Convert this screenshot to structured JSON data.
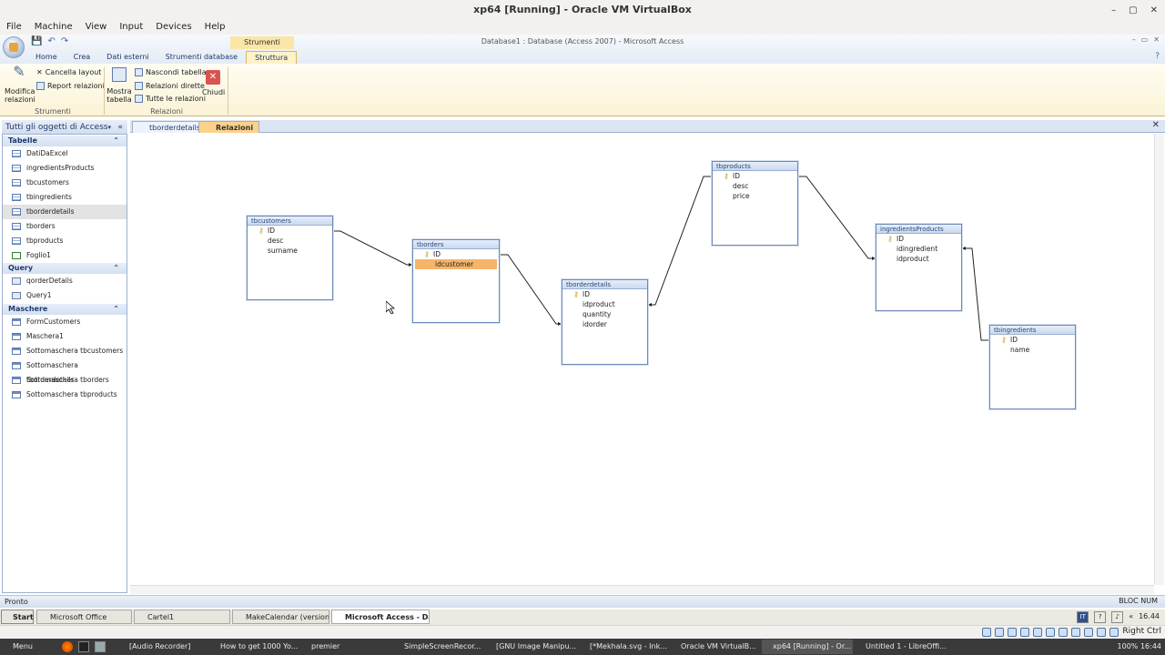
{
  "host": {
    "title": "xp64 [Running] - Oracle VM VirtualBox",
    "menu": [
      "File",
      "Machine",
      "View",
      "Input",
      "Devices",
      "Help"
    ],
    "window_controls": [
      "–",
      "▢",
      "✕"
    ]
  },
  "access": {
    "doc_title": "Database1 : Database (Access 2007) - Microsoft Access",
    "context_group": "Strumenti relazione",
    "tabs": [
      "Home",
      "Crea",
      "Dati esterni",
      "Strumenti database",
      "Struttura"
    ],
    "active_tab": "Struttura",
    "ribbon": {
      "modifica": "Modifica\nrelazioni",
      "cancella": "Cancella layout",
      "report": "Report relazioni",
      "mostra": "Mostra\ntabella",
      "nascondi": "Nascondi tabella",
      "dirette": "Relazioni dirette",
      "tutte": "Tutte le relazioni",
      "chiudi": "Chiudi",
      "group_strumenti": "Strumenti",
      "group_relazioni": "Relazioni"
    }
  },
  "nav": {
    "header": "Tutti gli oggetti di Access",
    "sections": [
      {
        "title": "Tabelle",
        "items": [
          "DatiDaExcel",
          "ingredientsProducts",
          "tbcustomers",
          "tbingredients",
          "tborderdetails",
          "tborders",
          "tbproducts",
          "Foglio1"
        ]
      },
      {
        "title": "Query",
        "items": [
          "qorderDetails",
          "Query1"
        ]
      },
      {
        "title": "Maschere",
        "items": [
          "FormCustomers",
          "Maschera1",
          "Sottomaschera tbcustomers",
          "Sottomaschera tborderdetails",
          "Sottomaschera tborders",
          "Sottomaschera tbproducts"
        ]
      }
    ],
    "selected": "tborderdetails"
  },
  "doc_tabs": [
    "tborderdetails",
    "Relazioni"
  ],
  "active_doc_tab": "Relazioni",
  "tables": {
    "tbcustomers": {
      "name": "tbcustomers",
      "fields": [
        "ID",
        "desc",
        "surname"
      ]
    },
    "tborders": {
      "name": "tborders",
      "fields": [
        "ID",
        "idcustomer"
      ]
    },
    "tborderdetails": {
      "name": "tborderdetails",
      "fields": [
        "ID",
        "idproduct",
        "quantity",
        "idorder"
      ]
    },
    "tbproducts": {
      "name": "tbproducts",
      "fields": [
        "ID",
        "desc",
        "price"
      ]
    },
    "ingredientsProducts": {
      "name": "ingredientsProducts",
      "fields": [
        "ID",
        "idingredient",
        "idproduct"
      ]
    },
    "tbingredients": {
      "name": "tbingredients",
      "fields": [
        "ID",
        "name"
      ]
    }
  },
  "status": {
    "left": "Pronto",
    "right": "BLOC NUM"
  },
  "guest_taskbar": {
    "start": "Start",
    "items": [
      "Microsoft Office",
      "Cartel1",
      "MakeCalendar (version 1...",
      "Microsoft Access - Da..."
    ],
    "active": "Microsoft Access - Da...",
    "lang": "IT",
    "clock": "16.44"
  },
  "vbox_status": {
    "host_key": "Right Ctrl"
  },
  "host_panel": {
    "items": [
      "Menu",
      "[Audio Recorder]",
      "How to get 1000 Yo...",
      "premier",
      "SimpleScreenRecor...",
      "[GNU Image Manipu...",
      "[*Mekhala.svg - Ink...",
      "Oracle VM VirtualB...",
      "xp64 [Running] - Or...",
      "Untitled 1 - LibreOffi..."
    ],
    "clock": "100% 16:44"
  },
  "colors": {
    "selected_field": "#f5b56a",
    "active_doc_tab": "#fbd28a"
  }
}
